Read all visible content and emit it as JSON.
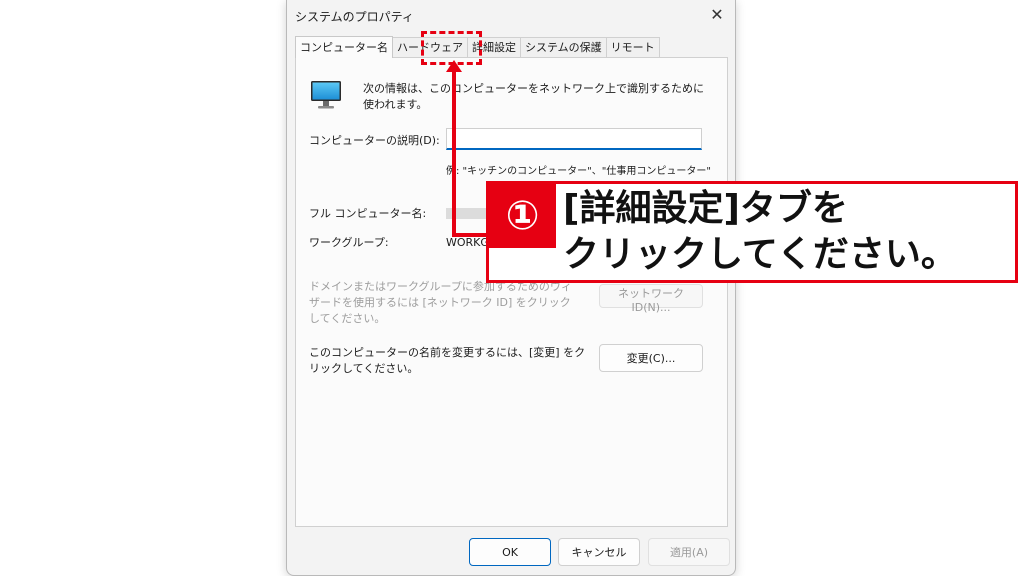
{
  "window": {
    "title": "システムのプロパティ",
    "close_symbol": "✕"
  },
  "tabs": [
    {
      "label": "コンピューター名",
      "active": true
    },
    {
      "label": "ハードウェア",
      "active": false
    },
    {
      "label": "詳細設定",
      "active": false
    },
    {
      "label": "システムの保護",
      "active": false
    },
    {
      "label": "リモート",
      "active": false
    }
  ],
  "panel": {
    "icon": "monitor-icon",
    "info_text": "次の情報は、このコンピューターをネットワーク上で識別するために使われます。",
    "description_label": "コンピューターの説明(D):",
    "description_value": "",
    "example_text": "例: \"キッチンのコンピューター\"、\"仕事用コンピューター\"",
    "full_name_label": "フル コンピューター名:",
    "workgroup_label": "ワークグループ:",
    "workgroup_value": "WORKG",
    "domain_text": "ドメインまたはワークグループに参加するためのウィザードを使用するには [ネットワーク ID] をクリックしてください。",
    "network_id_button": "ネットワーク ID(N)...",
    "rename_text": "このコンピューターの名前を変更するには、[変更] をクリックしてください。",
    "change_button": "変更(C)..."
  },
  "footer": {
    "ok_button": "OK",
    "cancel_button": "キャンセル",
    "apply_button": "適用(A)"
  },
  "annotation": {
    "number": "①",
    "line1": "[詳細設定]タブを",
    "line2": "クリックしてください。",
    "accent_color": "#e60012"
  }
}
